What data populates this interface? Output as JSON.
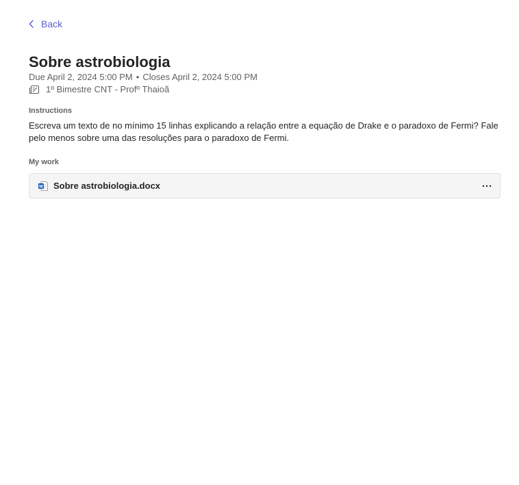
{
  "nav": {
    "back_label": "Back"
  },
  "assignment": {
    "title": "Sobre astrobiologia",
    "due": "Due April 2, 2024 5:00 PM",
    "separator": "•",
    "closes": "Closes April 2, 2024 5:00 PM",
    "class_name": "1º Bimestre CNT - Profº Thaioã"
  },
  "instructions": {
    "label": "Instructions",
    "text": "Escreva um texto de no mínimo 15 linhas explicando a relação entre a equação de Drake e o paradoxo de Fermi? Fale pelo menos sobre uma das resoluções para o paradoxo de Fermi."
  },
  "my_work": {
    "label": "My work",
    "files": [
      {
        "name": "Sobre astrobiologia.docx",
        "icon": "word-doc-icon"
      }
    ]
  },
  "colors": {
    "accent": "#5b5fc7",
    "word_blue": "#185abd",
    "text_primary": "#242424",
    "text_secondary": "#616161",
    "card_bg": "#f5f5f5"
  }
}
